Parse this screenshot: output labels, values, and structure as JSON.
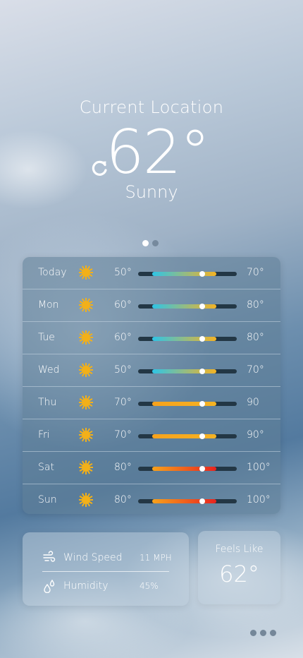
{
  "header": {
    "location": "Current Location",
    "temperature": "62°",
    "condition": "Sunny"
  },
  "pager": {
    "pages": 2,
    "active_page": 1
  },
  "forecast": [
    {
      "day": "Today",
      "icon": "sun-icon",
      "low": "50°",
      "high": "70°",
      "bar_start": 0.14,
      "bar_end": 0.79,
      "current": 0.65,
      "gradient": [
        "#2fc4e6",
        "#f4b324"
      ]
    },
    {
      "day": "Mon",
      "icon": "sun-icon",
      "low": "60°",
      "high": "80°",
      "bar_start": 0.14,
      "bar_end": 0.79,
      "current": 0.65,
      "gradient": [
        "#2fc4e6",
        "#f4b324"
      ]
    },
    {
      "day": "Tue",
      "icon": "sun-icon",
      "low": "60°",
      "high": "80°",
      "bar_start": 0.14,
      "bar_end": 0.79,
      "current": 0.65,
      "gradient": [
        "#2fc4e6",
        "#f4b324"
      ]
    },
    {
      "day": "Wed",
      "icon": "sun-icon",
      "low": "50°",
      "high": "70°",
      "bar_start": 0.14,
      "bar_end": 0.79,
      "current": 0.65,
      "gradient": [
        "#2fc4e6",
        "#f4b324"
      ]
    },
    {
      "day": "Thu",
      "icon": "sun-icon",
      "low": "70°",
      "high": "90",
      "bar_start": 0.14,
      "bar_end": 0.79,
      "current": 0.65,
      "gradient": [
        "#f7a21b",
        "#f4b324"
      ]
    },
    {
      "day": "Fri",
      "icon": "sun-icon",
      "low": "70°",
      "high": "90°",
      "bar_start": 0.14,
      "bar_end": 0.79,
      "current": 0.65,
      "gradient": [
        "#f7a21b",
        "#f4b324"
      ]
    },
    {
      "day": "Sat",
      "icon": "sun-icon",
      "low": "80°",
      "high": "100°",
      "bar_start": 0.14,
      "bar_end": 0.79,
      "current": 0.65,
      "gradient": [
        "#f7a21b",
        "#e8231f"
      ]
    },
    {
      "day": "Sun",
      "icon": "sun-icon",
      "low": "80°",
      "high": "100°",
      "bar_start": 0.14,
      "bar_end": 0.79,
      "current": 0.65,
      "gradient": [
        "#f7a21b",
        "#e8231f"
      ]
    }
  ],
  "details": {
    "wind_label": "Wind Speed",
    "wind_value": "11 MPH",
    "wind_icon": "wind-icon",
    "humidity_label": "Humidity",
    "humidity_value": "45%",
    "humidity_icon": "humidity-icon",
    "feels_label": "Feels Like",
    "feels_value": "62°"
  },
  "colors": {
    "sun": "#f2b019",
    "track": "#233745"
  }
}
